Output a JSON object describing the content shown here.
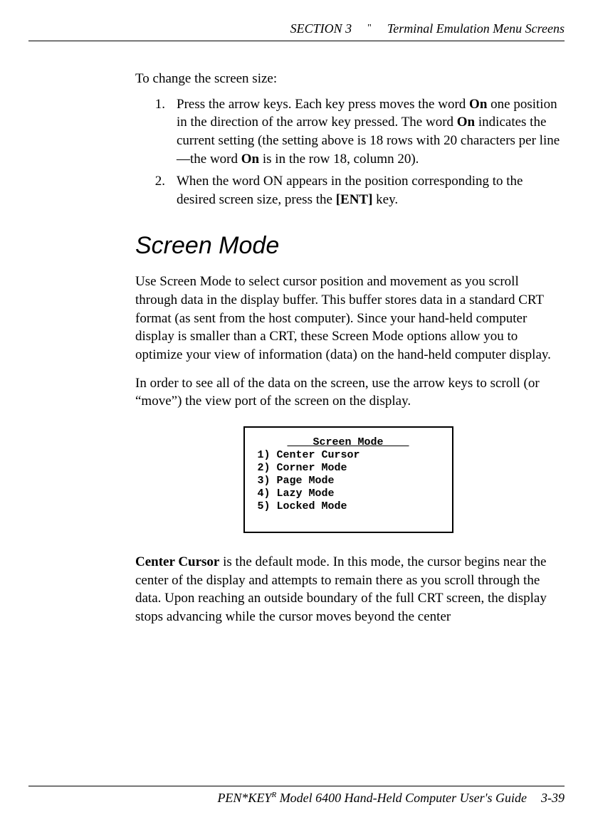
{
  "header": {
    "section": "SECTION 3",
    "quote": "\"",
    "title": "Terminal Emulation Menu Screens"
  },
  "intro": "To change the screen size:",
  "steps": {
    "s1_num": "1.",
    "s1": {
      "a": "Press the arrow keys.  Each key press moves the word ",
      "b": "On",
      "c": " one position in the direction of the arrow key pressed.  The word ",
      "d": "On",
      "e": " indicates the current setting (the setting above is 18 rows with 20 characters per line—the word ",
      "f": "On",
      "g": " is in the row 18, column 20)."
    },
    "s2_num": "2.",
    "s2": {
      "a": "When the word ON appears in the position corresponding to the desired screen size, press the ",
      "b": "[ENT]",
      "c": " key."
    }
  },
  "heading": "Screen Mode",
  "p1": "Use Screen Mode to select cursor position and movement as you scroll through data in the display buffer.  This buffer stores data in a standard CRT format (as sent from the host computer).  Since your hand-held computer display is smaller than a CRT, these Screen Mode options allow you to optimize your view of information (data) on the hand-held computer display.",
  "p2": "In order to see all of the data on the screen, use the arrow keys to scroll (or “move”) the view port of the screen on the display.",
  "menu": {
    "title": "    Screen Mode    ",
    "i1": "1) Center Cursor",
    "i2": "2) Corner Mode",
    "i3": "3) Page Mode",
    "i4": "4) Lazy Mode",
    "i5": "5) Locked Mode"
  },
  "p3": {
    "a": "Center Cursor",
    "b": " is the default mode.  In this mode, the cursor begins near the center of the display and attempts to remain there as you scroll through the data.  Upon reaching an outside boundary of the full CRT screen, the display stops advancing while the cursor moves beyond the center"
  },
  "footer": {
    "book": "PEN*KEY",
    "sup": "R",
    "model": " Model 6400 Hand-Held Computer User's Guide",
    "page": "3-39"
  }
}
